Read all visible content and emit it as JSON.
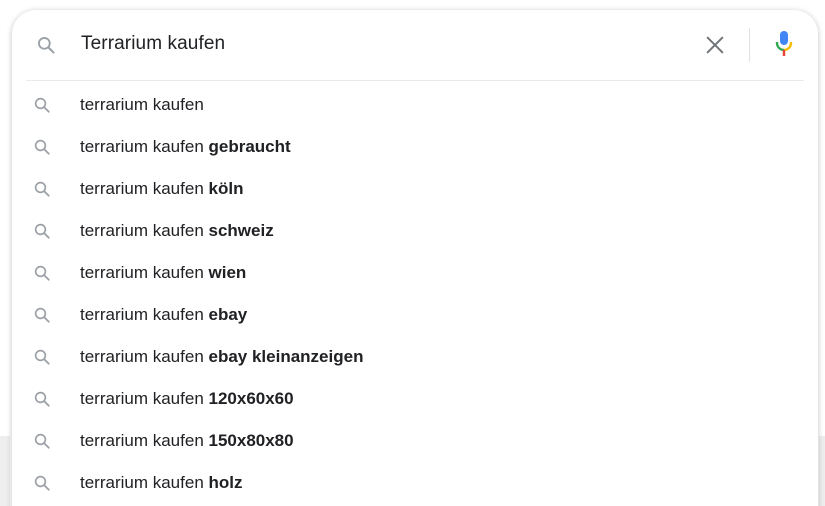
{
  "search": {
    "query": "Terrarium kaufen",
    "icons": {
      "search": "search-icon",
      "clear": "close-icon",
      "voice": "microphone-icon"
    }
  },
  "suggestions": [
    {
      "prefix": "terrarium kaufen",
      "completion": ""
    },
    {
      "prefix": "terrarium kaufen",
      "completion": "gebraucht"
    },
    {
      "prefix": "terrarium kaufen",
      "completion": "köln"
    },
    {
      "prefix": "terrarium kaufen",
      "completion": "schweiz"
    },
    {
      "prefix": "terrarium kaufen",
      "completion": "wien"
    },
    {
      "prefix": "terrarium kaufen",
      "completion": "ebay"
    },
    {
      "prefix": "terrarium kaufen",
      "completion": "ebay kleinanzeigen"
    },
    {
      "prefix": "terrarium kaufen",
      "completion": "120x60x60"
    },
    {
      "prefix": "terrarium kaufen",
      "completion": "150x80x80"
    },
    {
      "prefix": "terrarium kaufen",
      "completion": "holz"
    }
  ],
  "colors": {
    "text": "#202124",
    "icon_grey": "#9aa0a6",
    "mic_blue": "#4285f4",
    "mic_red": "#ea4335",
    "mic_yellow": "#fbbc05",
    "mic_green": "#34a853"
  }
}
